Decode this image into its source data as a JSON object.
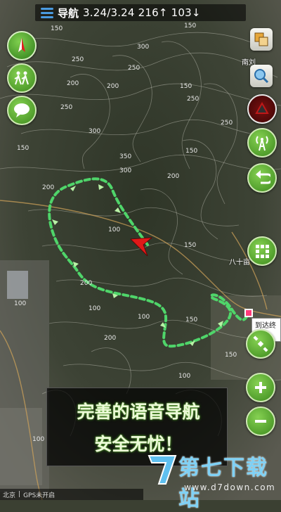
{
  "header": {
    "title": "导航",
    "stats": "3.24/3.24 216↑ 103↓"
  },
  "place_labels": {
    "nanyu": "南刘",
    "bashiyi": "八十亩"
  },
  "end_label": "到达终点",
  "contour_labels": [
    "150",
    "250",
    "150",
    "300",
    "250",
    "200",
    "150",
    "200",
    "250",
    "300",
    "350",
    "300",
    "150",
    "200",
    "150",
    "200",
    "250",
    "250",
    "100",
    "150",
    "200",
    "100",
    "100",
    "100",
    "200",
    "150",
    "100",
    "150",
    "100"
  ],
  "promo": {
    "line1": "完善的语音导航",
    "line2": "安全无忧！"
  },
  "status_bar": {
    "city": "北京",
    "gps": "GPS未开启"
  },
  "watermark": {
    "title": "第七下载站",
    "url": "www.d7down.com"
  },
  "colors": {
    "route": "#4fd56a",
    "accent_green": "#3c8a1d",
    "marker": "#e01919"
  },
  "icons": {
    "compass": "compass-icon",
    "hikers": "hikers-icon",
    "chat": "chat-bubble-icon",
    "layers": "layers-icon",
    "search": "search-icon",
    "track": "track-icon",
    "signal": "signal-tower-icon",
    "back": "back-arrow-icon",
    "grid": "grid-icon",
    "satellite": "satellite-icon",
    "zoom_in": "zoom-in-icon",
    "zoom_out": "zoom-out-icon"
  }
}
